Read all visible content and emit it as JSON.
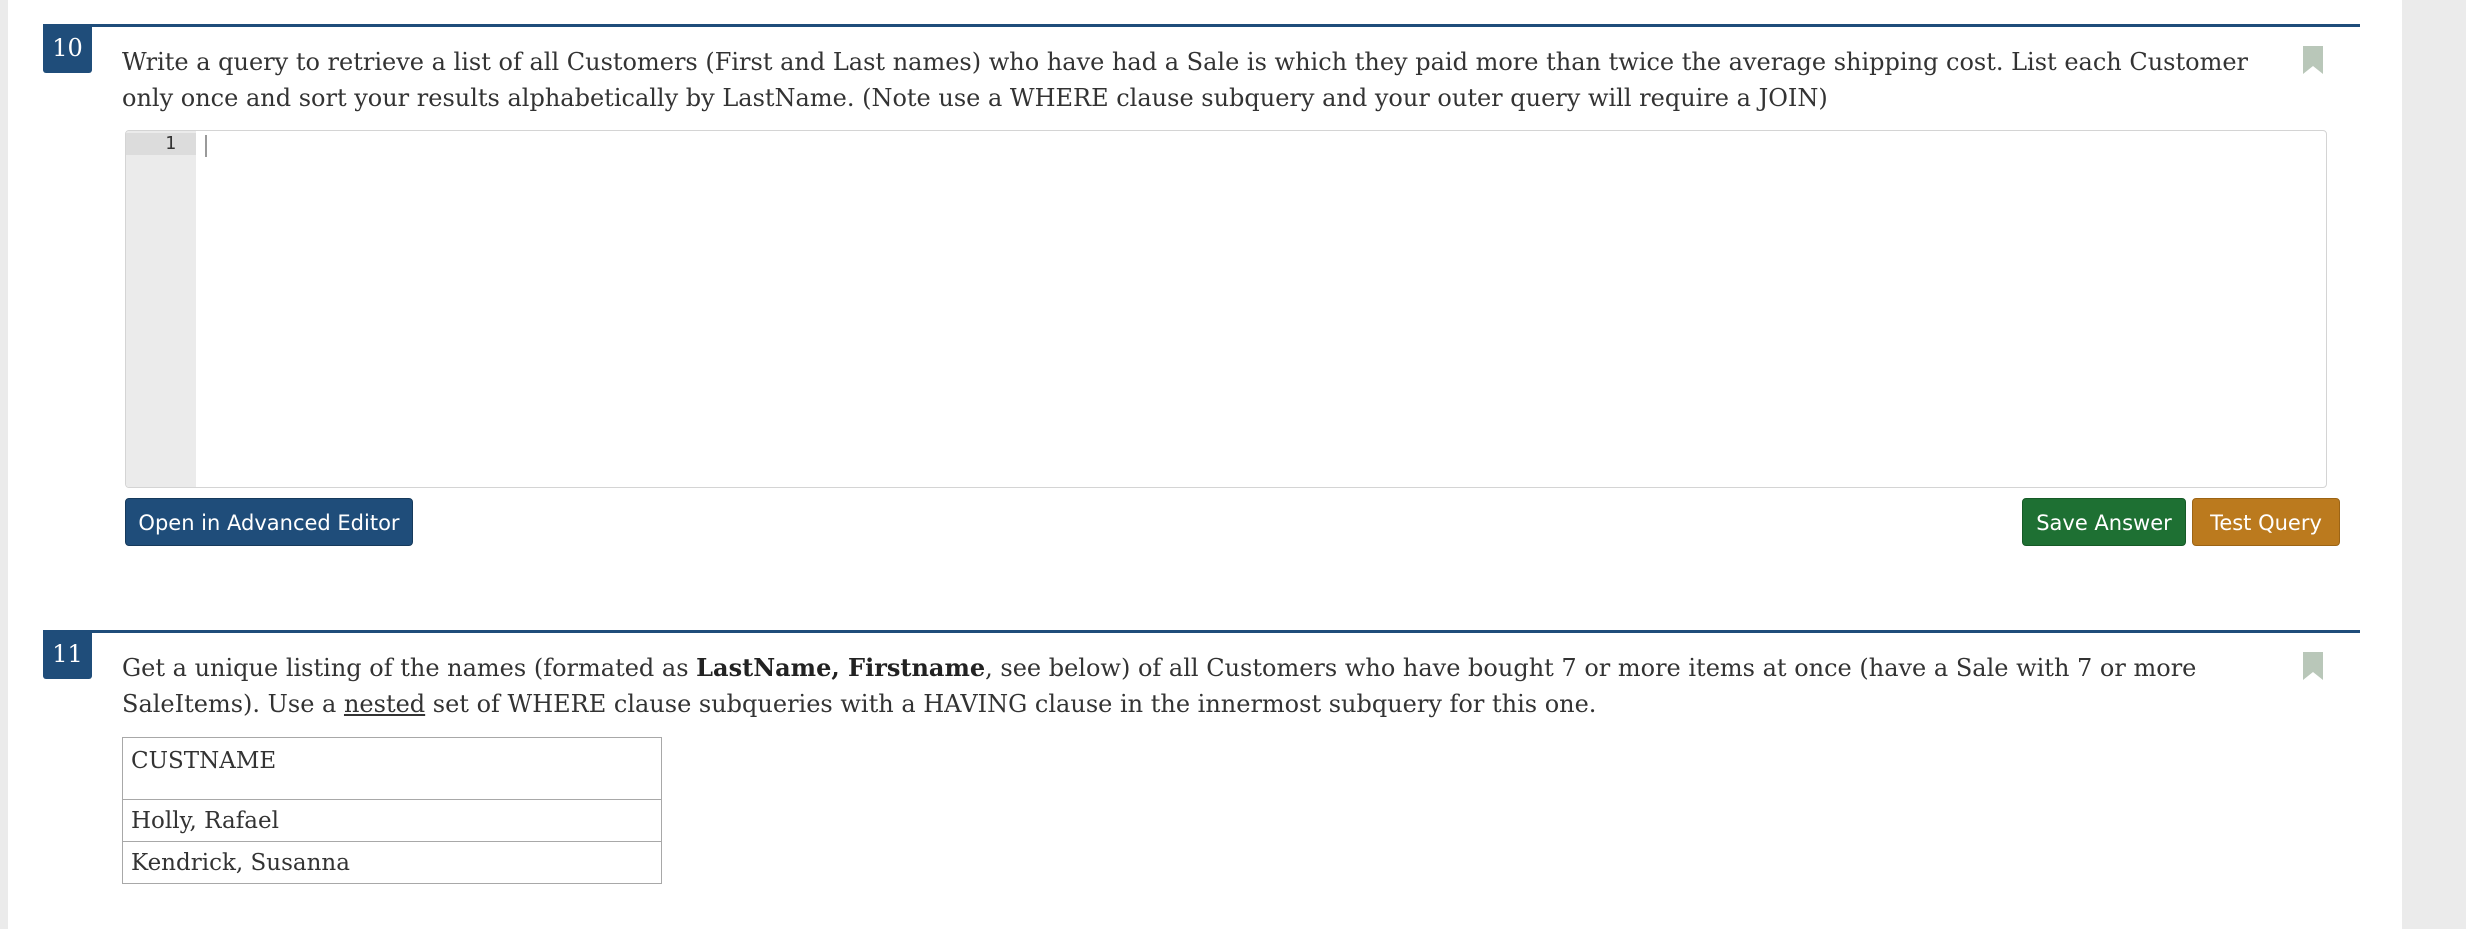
{
  "questions": [
    {
      "number": "10",
      "text": "Write a query to retrieve a list of all Customers (First and Last names) who have had a Sale is which they paid more than twice the average shipping cost. List each Customer only once and sort your results alphabetically by LastName. (Note use a WHERE clause subquery and your outer query will require a JOIN)",
      "editor": {
        "line_number": "1",
        "value": ""
      },
      "buttons": {
        "advanced_editor": "Open in Advanced Editor",
        "save_answer": "Save Answer",
        "test_query": "Test Query"
      }
    },
    {
      "number": "11",
      "text_parts": {
        "p1": "Get a unique listing of the names (formated as ",
        "bold": "LastName, Firstname",
        "p2": ", see below) of all Customers who have bought 7 or more items at once (have a Sale with 7 or more SaleItems). Use a ",
        "underline": "nested",
        "p3": " set of WHERE clause subqueries with a HAVING clause in the innermost subquery for this one."
      },
      "table": {
        "header": "CUSTNAME",
        "rows": [
          "Holly, Rafael",
          "Kendrick, Susanna"
        ]
      }
    }
  ],
  "icons": {
    "bookmark": "bookmark-icon"
  },
  "colors": {
    "primary": "#1f4d7a",
    "save": "#1e7033",
    "test": "#bb7a1e",
    "bookmark": "#b9c7b9"
  }
}
